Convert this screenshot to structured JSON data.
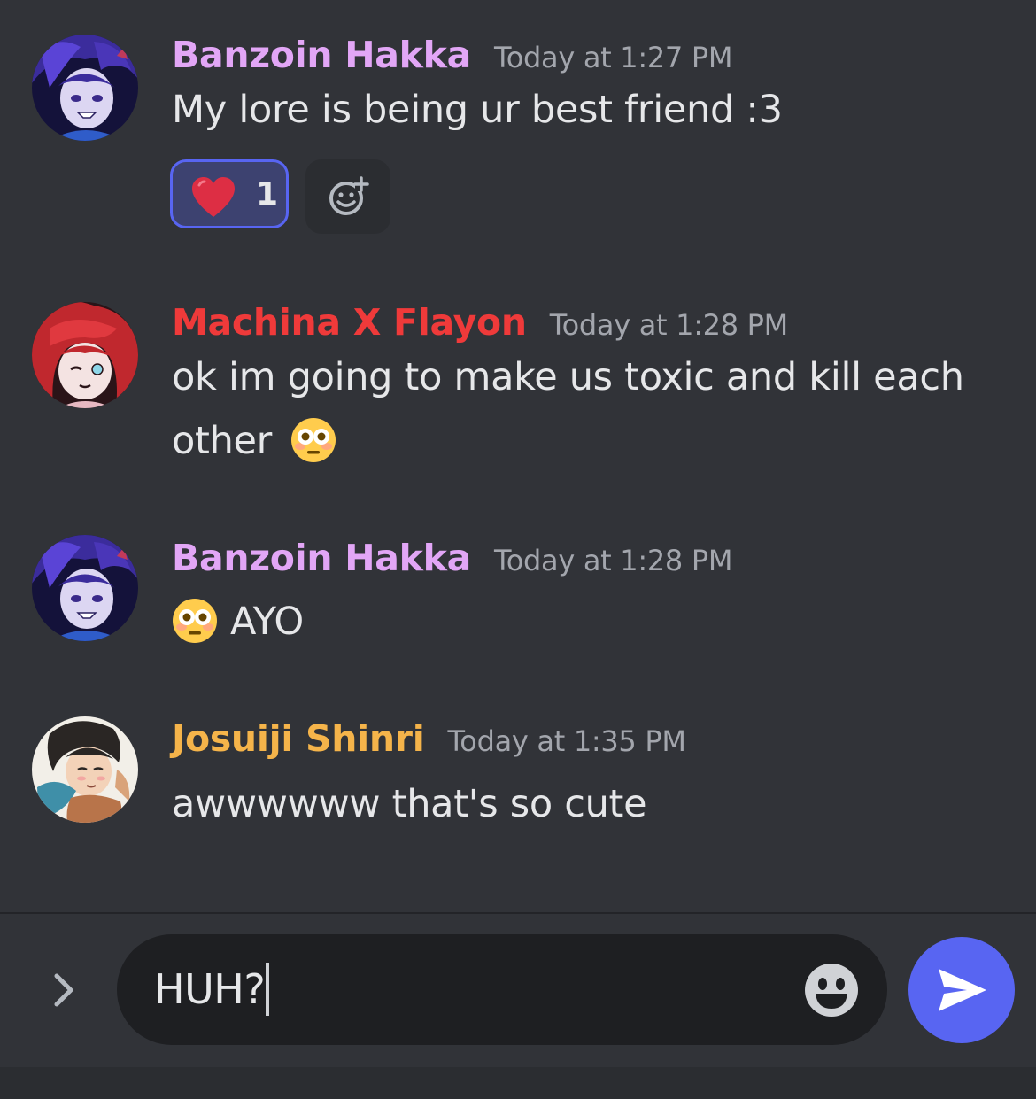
{
  "messages": [
    {
      "username": "Banzoin Hakka",
      "username_color": "#e2a6f6",
      "timestamp": "Today at 1:27 PM",
      "text": "My lore is being ur best friend :3",
      "reactions": [
        {
          "emoji": "red-heart",
          "count": "1",
          "selected": true
        }
      ]
    },
    {
      "username": "Machina X Flayon",
      "username_color": "#ef3a3a",
      "timestamp": "Today at 1:28 PM",
      "text_line1": "ok im going to make us toxic and kill each",
      "text_line2": "other",
      "trailing_emoji": "flushed-face"
    },
    {
      "username": "Banzoin Hakka",
      "username_color": "#e2a6f6",
      "timestamp": "Today at 1:28 PM",
      "leading_emoji": "flushed-face",
      "text": "AYO"
    },
    {
      "username": "Josuiji Shinri",
      "username_color": "#f5b44a",
      "timestamp": "Today at 1:35 PM",
      "text": "awwwwww that's so cute"
    }
  ],
  "composer": {
    "value": "HUH?",
    "expand_icon": "chevron-right-icon",
    "emoji_icon": "smiley-icon",
    "send_icon": "paper-plane-icon"
  },
  "colors": {
    "background": "#313338",
    "input_background": "#1e1f22",
    "accent": "#5865f2",
    "timestamp": "#a3a6ad",
    "text": "#e6e7e9"
  }
}
